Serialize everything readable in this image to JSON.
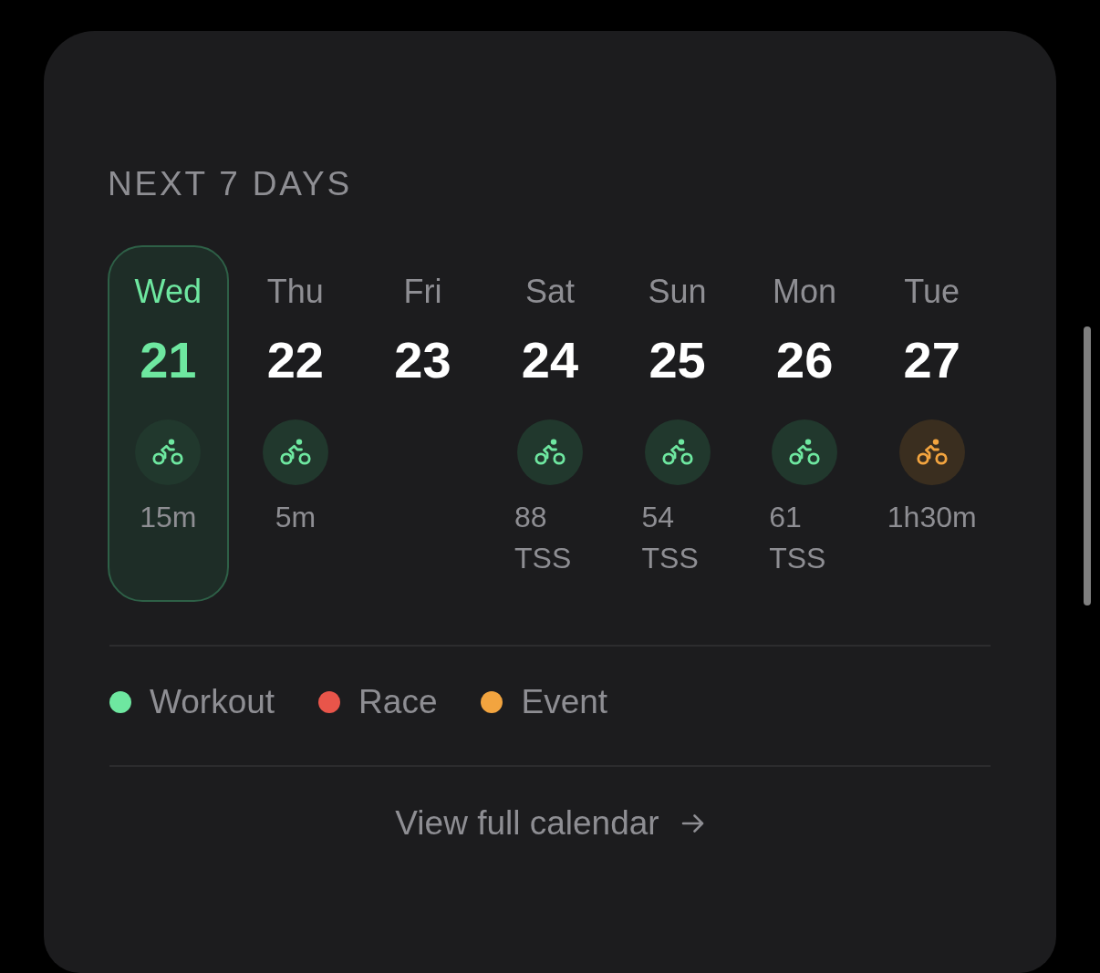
{
  "card": {
    "title": "NEXT 7 DAYS",
    "days": [
      {
        "weekday": "Wed",
        "date": "21",
        "selected": true,
        "activity": {
          "kind": "workout",
          "reading": "15m"
        }
      },
      {
        "weekday": "Thu",
        "date": "22",
        "selected": false,
        "activity": {
          "kind": "workout",
          "reading": "5m"
        }
      },
      {
        "weekday": "Fri",
        "date": "23",
        "selected": false
      },
      {
        "weekday": "Sat",
        "date": "24",
        "selected": false,
        "activity": {
          "kind": "workout",
          "reading": "88 TSS"
        }
      },
      {
        "weekday": "Sun",
        "date": "25",
        "selected": false,
        "activity": {
          "kind": "workout",
          "reading": "54 TSS"
        }
      },
      {
        "weekday": "Mon",
        "date": "26",
        "selected": false,
        "activity": {
          "kind": "workout",
          "reading": "61 TSS"
        }
      },
      {
        "weekday": "Tue",
        "date": "27",
        "selected": false,
        "activity": {
          "kind": "event",
          "reading": "1h30m"
        }
      }
    ],
    "legend": [
      {
        "label": "Workout",
        "color": "#6ee7a0"
      },
      {
        "label": "Race",
        "color": "#e8554a"
      },
      {
        "label": "Event",
        "color": "#f2a43f"
      }
    ],
    "footer_link": "View full calendar"
  }
}
